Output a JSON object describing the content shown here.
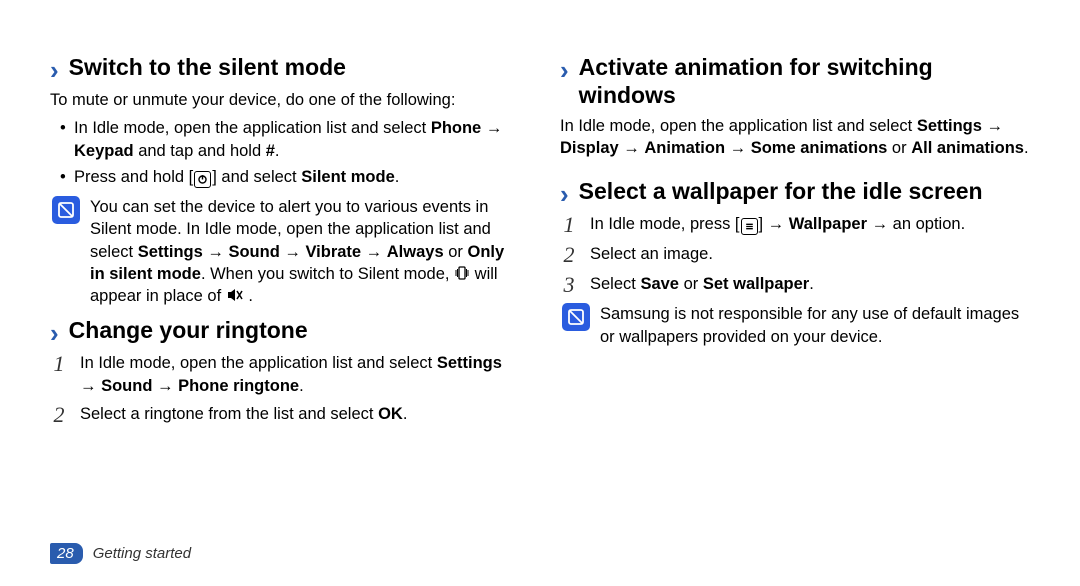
{
  "left": {
    "h1": "Switch to the silent mode",
    "intro": "To mute or unmute your device, do one of the following:",
    "bullet1_a": "In Idle mode, open the application list and select ",
    "bullet1_b": "Phone",
    "bullet1_c": " → ",
    "bullet1_d": "Keypad",
    "bullet1_e": " and tap and hold ",
    "bullet1_f": "#",
    "bullet1_g": ".",
    "bullet2_a": "Press and hold [",
    "bullet2_b": "] and select ",
    "bullet2_c": "Silent mode",
    "bullet2_d": ".",
    "note_a": "You can set the device to alert you to various events in Silent mode. In Idle mode, open the application list and select ",
    "note_b": "Settings",
    "note_c": " → ",
    "note_d": "Sound",
    "note_e": " → ",
    "note_f": "Vibrate",
    "note_g": " → ",
    "note_h": "Always",
    "note_i": " or ",
    "note_j": "Only in silent mode",
    "note_k": ". When you switch to Silent mode, ",
    "note_l": " will appear in place of ",
    "note_m": " .",
    "h2": "Change your ringtone",
    "step1_a": "In Idle mode, open the application list and select ",
    "step1_b": "Settings",
    "step1_c": " → ",
    "step1_d": "Sound",
    "step1_e": " → ",
    "step1_f": "Phone ringtone",
    "step1_g": ".",
    "step2_a": "Select a ringtone from the list and select ",
    "step2_b": "OK",
    "step2_c": "."
  },
  "right": {
    "h1": "Activate animation for switching windows",
    "p1_a": "In Idle mode, open the application list and select ",
    "p1_b": "Settings",
    "p1_c": " → ",
    "p1_d": "Display",
    "p1_e": " → ",
    "p1_f": "Animation",
    "p1_g": " → ",
    "p1_h": "Some animations",
    "p1_i": " or ",
    "p1_j": "All animations",
    "p1_k": ".",
    "h2": "Select a wallpaper for the idle screen",
    "step1_a": "In Idle mode, press [",
    "step1_b": "] → ",
    "step1_c": "Wallpaper",
    "step1_d": " → an option.",
    "step2": "Select an image.",
    "step3_a": "Select ",
    "step3_b": "Save",
    "step3_c": " or ",
    "step3_d": "Set wallpaper",
    "step3_e": ".",
    "note": "Samsung is not responsible for any use of default images or wallpapers provided on your device."
  },
  "nums": {
    "n1": "1",
    "n2": "2",
    "n3": "3"
  },
  "footer": {
    "page": "28",
    "chapter": "Getting started"
  }
}
